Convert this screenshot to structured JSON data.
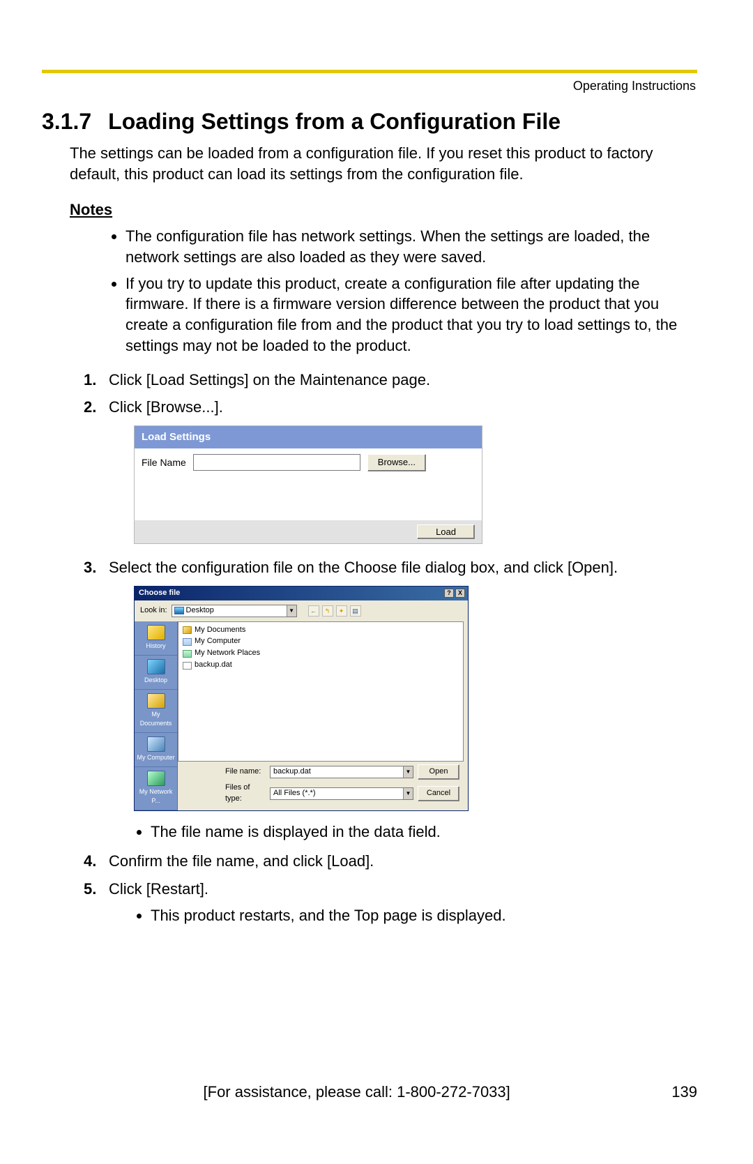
{
  "header": {
    "label": "Operating Instructions"
  },
  "section": {
    "number": "3.1.7",
    "title": "Loading Settings from a Configuration File",
    "intro": "The settings can be loaded from a configuration file. If you reset this product to factory default, this product can load its settings from the configuration file."
  },
  "notes_heading": "Notes",
  "notes": [
    "The configuration file has network settings. When the settings are loaded, the network settings are also loaded as they were saved.",
    "If you try to update this product, create a configuration file after updating the firmware. If there is a firmware version difference between the product that you create a configuration file from and the product that you try to load settings to, the settings may not be loaded to the product."
  ],
  "steps": {
    "s1": "Click [Load Settings] on the Maintenance page.",
    "s2": "Click [Browse...].",
    "s3": "Select the configuration file on the Choose file dialog box, and click [Open].",
    "s3_sub": "The file name is displayed in the data field.",
    "s4": "Confirm the file name, and click [Load].",
    "s5": "Click [Restart].",
    "s5_sub": "This product restarts, and the Top page is displayed."
  },
  "load_panel": {
    "title": "Load Settings",
    "filename_label": "File Name",
    "filename_value": "",
    "browse_btn": "Browse...",
    "load_btn": "Load"
  },
  "choose_dialog": {
    "title": "Choose file",
    "lookin_label": "Look in:",
    "lookin_value": "Desktop",
    "places": {
      "history": "History",
      "desktop": "Desktop",
      "mydocs": "My Documents",
      "mycomp": "My Computer",
      "mynet": "My Network P..."
    },
    "files": {
      "mydocs": "My Documents",
      "mycomp": "My Computer",
      "mynet": "My Network Places",
      "backup": "backup.dat"
    },
    "filename_label": "File name:",
    "filename_value": "backup.dat",
    "filetype_label": "Files of type:",
    "filetype_value": "All Files (*.*)",
    "open_btn": "Open",
    "cancel_btn": "Cancel"
  },
  "footer": {
    "assist": "[For assistance, please call: 1-800-272-7033]",
    "page": "139"
  }
}
